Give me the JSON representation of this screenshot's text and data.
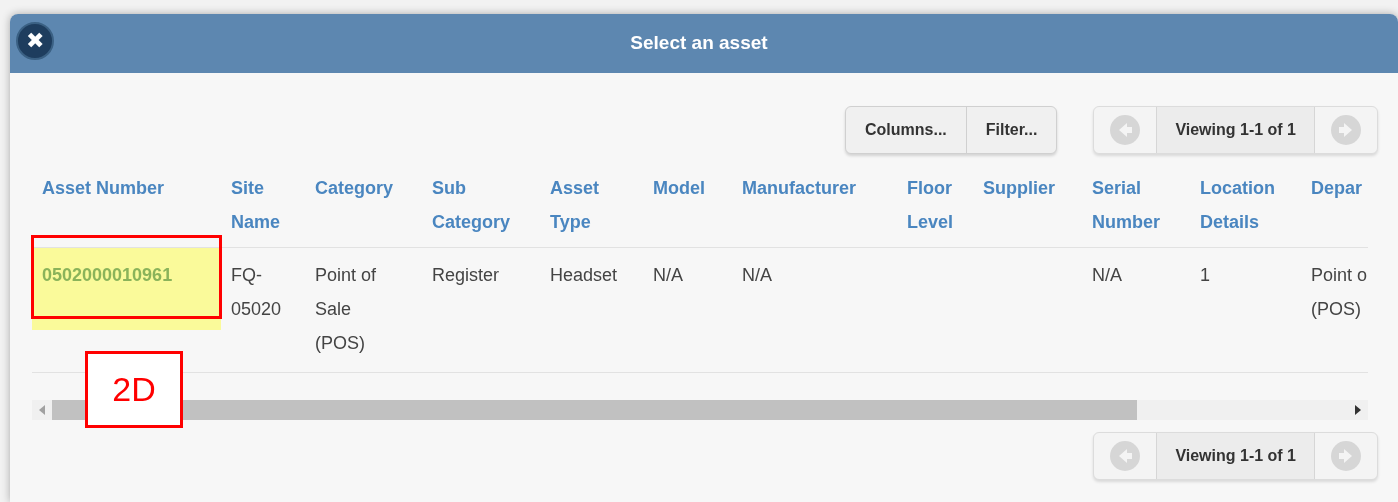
{
  "dialog": {
    "title": "Select an asset",
    "close_glyph": "✖"
  },
  "toolbar": {
    "buttons": [
      "Columns...",
      "Filter..."
    ]
  },
  "pager_top": {
    "text": "Viewing 1-1 of 1"
  },
  "table": {
    "columns": [
      "Asset Number",
      "Site Name",
      "Category",
      "Sub Category",
      "Asset Type",
      "Model",
      "Manufacturer",
      "Floor Level",
      "Supplier",
      "Serial Number",
      "Location Details",
      "Depar"
    ],
    "rows": [
      {
        "selected": true,
        "cells": [
          "0502000010961",
          "FQ-\n05020",
          "Point of\nSale\n(POS)",
          "Register",
          "Headset",
          "N/A",
          "N/A",
          "",
          "",
          "N/A",
          "1",
          "Point o\n(POS)"
        ]
      }
    ]
  },
  "pager_bottom": {
    "text": "Viewing 1-1 of 1"
  },
  "annotations": [
    {
      "kind": "highlight-box"
    },
    {
      "kind": "callout",
      "label": "2D"
    }
  ]
}
